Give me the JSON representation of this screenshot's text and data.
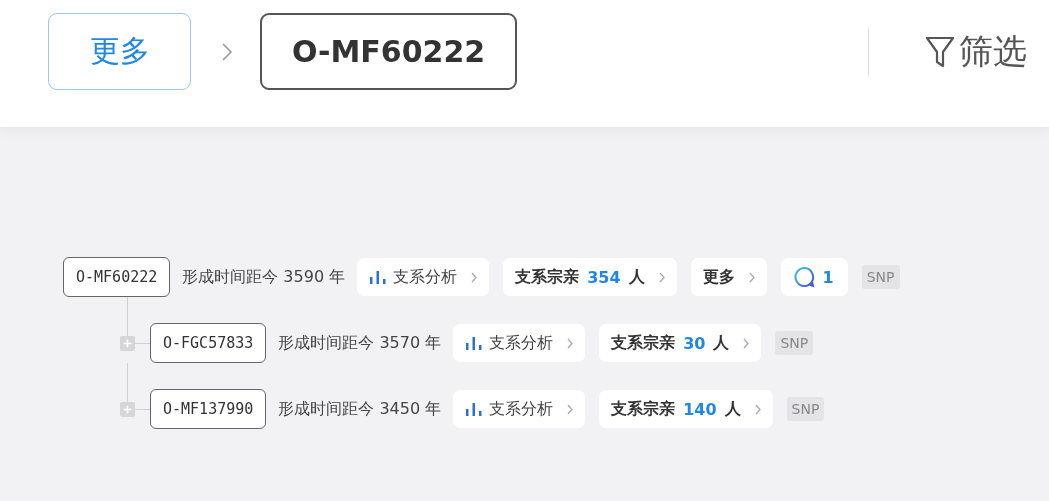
{
  "header": {
    "breadcrumb": [
      {
        "label": "更多",
        "selected": false
      },
      {
        "label": "O-MF60222",
        "selected": true
      }
    ],
    "filter": {
      "label": "筛选"
    }
  },
  "tree": {
    "label": "O-MF60222",
    "age": "形成时间距今 3590 年",
    "analysis": "支系分析",
    "relatives": {
      "prefix": "支系宗亲",
      "count": "354",
      "suffix": "人"
    },
    "more": "更多",
    "comments": "1",
    "tag": "SNP",
    "children": [
      {
        "label": "O-FGC57833",
        "age": "形成时间距今 3570 年",
        "analysis": "支系分析",
        "relatives": {
          "prefix": "支系宗亲",
          "count": "30",
          "suffix": "人"
        },
        "tag": "SNP",
        "expanded": false
      },
      {
        "label": "O-MF137990",
        "age": "形成时间距今 3450 年",
        "analysis": "支系分析",
        "relatives": {
          "prefix": "支系宗亲",
          "count": "140",
          "suffix": "人"
        },
        "tag": "SNP",
        "expanded": false
      }
    ]
  }
}
